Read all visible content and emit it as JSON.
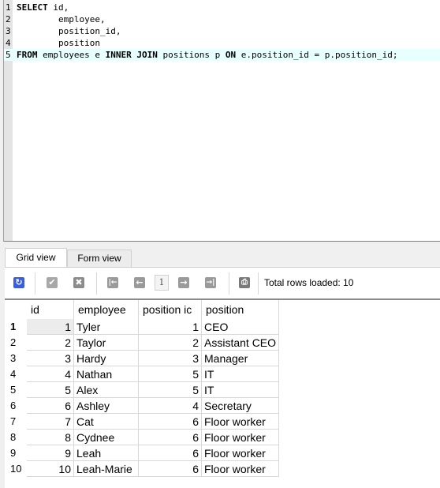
{
  "editor": {
    "lines": [
      {
        "num": "1",
        "parts": [
          {
            "t": "SELECT",
            "kw": true
          },
          {
            "t": " id,",
            "kw": false
          }
        ]
      },
      {
        "num": "2",
        "parts": [
          {
            "t": "        employee,",
            "kw": false
          }
        ]
      },
      {
        "num": "3",
        "parts": [
          {
            "t": "        position_id,",
            "kw": false
          }
        ]
      },
      {
        "num": "4",
        "parts": [
          {
            "t": "        position",
            "kw": false
          }
        ]
      },
      {
        "num": "5",
        "parts": [
          {
            "t": "FROM",
            "kw": true
          },
          {
            "t": " employees e ",
            "kw": false
          },
          {
            "t": "INNER JOIN",
            "kw": true
          },
          {
            "t": " positions p ",
            "kw": false
          },
          {
            "t": "ON",
            "kw": true
          },
          {
            "t": " e.position_id = p.position_id;",
            "kw": false
          }
        ]
      }
    ],
    "current_line": 5
  },
  "tabs": [
    {
      "label": "Grid view",
      "active": true
    },
    {
      "label": "Form view",
      "active": false
    }
  ],
  "toolbar": {
    "refresh_icon": "refresh-icon",
    "commit_icon": "check-icon",
    "rollback_icon": "cancel-icon",
    "first_icon": "first-page-icon",
    "prev_icon": "prev-page-icon",
    "page": "1",
    "next_icon": "next-page-icon",
    "last_icon": "last-page-icon",
    "print_icon": "print-icon",
    "total_rows": "Total rows loaded: 10"
  },
  "grid": {
    "columns": [
      "id",
      "employee",
      "position_id",
      "position"
    ],
    "column_labels_visible": [
      "id",
      "employee",
      "position ic",
      "position"
    ],
    "rows": [
      [
        "1",
        "Tyler",
        "1",
        "CEO"
      ],
      [
        "2",
        "Taylor",
        "2",
        "Assistant CEO"
      ],
      [
        "3",
        "Hardy",
        "3",
        "Manager"
      ],
      [
        "4",
        "Nathan",
        "5",
        "IT"
      ],
      [
        "5",
        "Alex",
        "5",
        "IT"
      ],
      [
        "6",
        "Ashley",
        "4",
        "Secretary"
      ],
      [
        "7",
        "Cat",
        "6",
        "Floor worker"
      ],
      [
        "8",
        "Cydnee",
        "6",
        "Floor worker"
      ],
      [
        "9",
        "Leah",
        "6",
        "Floor worker"
      ],
      [
        "10",
        "Leah-Marie",
        "6",
        "Floor worker"
      ]
    ],
    "row_numbers": [
      "1",
      "2",
      "3",
      "4",
      "5",
      "6",
      "7",
      "8",
      "9",
      "10"
    ],
    "selected_row": 1
  },
  "colors": {
    "refresh": "#3a5de0",
    "disabled_icon": "#9a9a9a",
    "current_line": "#e8ffff"
  }
}
